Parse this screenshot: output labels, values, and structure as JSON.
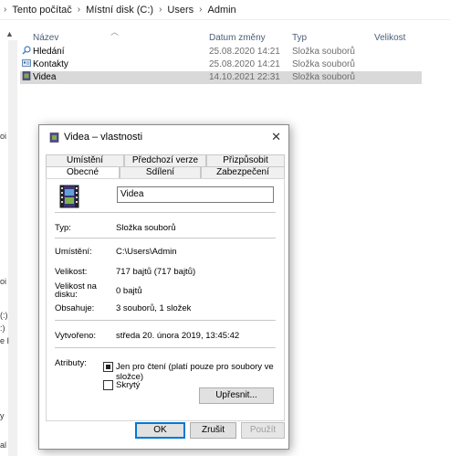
{
  "breadcrumb": {
    "items": [
      "Tento počítač",
      "Místní disk (C:)",
      "Users",
      "Admin"
    ],
    "separator": "›",
    "leading_separator": "›"
  },
  "nav_fragments": [
    "oi",
    "oi",
    "(:)",
    ":)",
    "e I",
    "y",
    "al"
  ],
  "columns": {
    "name": "Název",
    "date": "Datum změny",
    "type": "Typ",
    "size": "Velikost"
  },
  "files": [
    {
      "name": "Hledání",
      "date": "25.08.2020 14:21",
      "type": "Složka souborů",
      "icon": "search-folder-icon",
      "selected": false
    },
    {
      "name": "Kontakty",
      "date": "25.08.2020 14:21",
      "type": "Složka souborů",
      "icon": "contacts-folder-icon",
      "selected": false
    },
    {
      "name": "Videa",
      "date": "14.10.2021 22:31",
      "type": "Složka souborů",
      "icon": "videos-folder-icon",
      "selected": true
    }
  ],
  "dialog": {
    "title": "Videa – vlastnosti",
    "close_glyph": "✕",
    "tabs_row1": [
      "Umístění",
      "Předchozí verze",
      "Přizpůsobit"
    ],
    "tabs_row2": [
      "Obecné",
      "Sdílení",
      "Zabezpečení"
    ],
    "active_tab": "Obecné",
    "folder_name": "Videa",
    "props": {
      "type_label": "Typ:",
      "type_value": "Složka souborů",
      "location_label": "Umístění:",
      "location_value": "C:\\Users\\Admin",
      "size_label": "Velikost:",
      "size_value": "717 bajtů (717 bajtů)",
      "disk_size_label_1": "Velikost na",
      "disk_size_label_2": "disku:",
      "disk_size_value": "0 bajtů",
      "contains_label": "Obsahuje:",
      "contains_value": "3 souborů, 1 složek",
      "created_label": "Vytvořeno:",
      "created_value": "středa 20. února 2019, 13:45:42",
      "attributes_label": "Atributy:"
    },
    "readonly_label": "Jen pro čtení (platí pouze pro soubory ve složce)",
    "readonly_state": "indeterminate",
    "hidden_label": "Skrytý",
    "hidden_state": "unchecked",
    "advanced_button": "Upřesnit...",
    "ok_button": "OK",
    "cancel_button": "Zrušit",
    "apply_button": "Použít"
  },
  "colors": {
    "selection": "#d9d9d9",
    "column_header": "#4c607a",
    "secondary_text": "#6d6d6d",
    "default_button_border": "#0078d7"
  }
}
